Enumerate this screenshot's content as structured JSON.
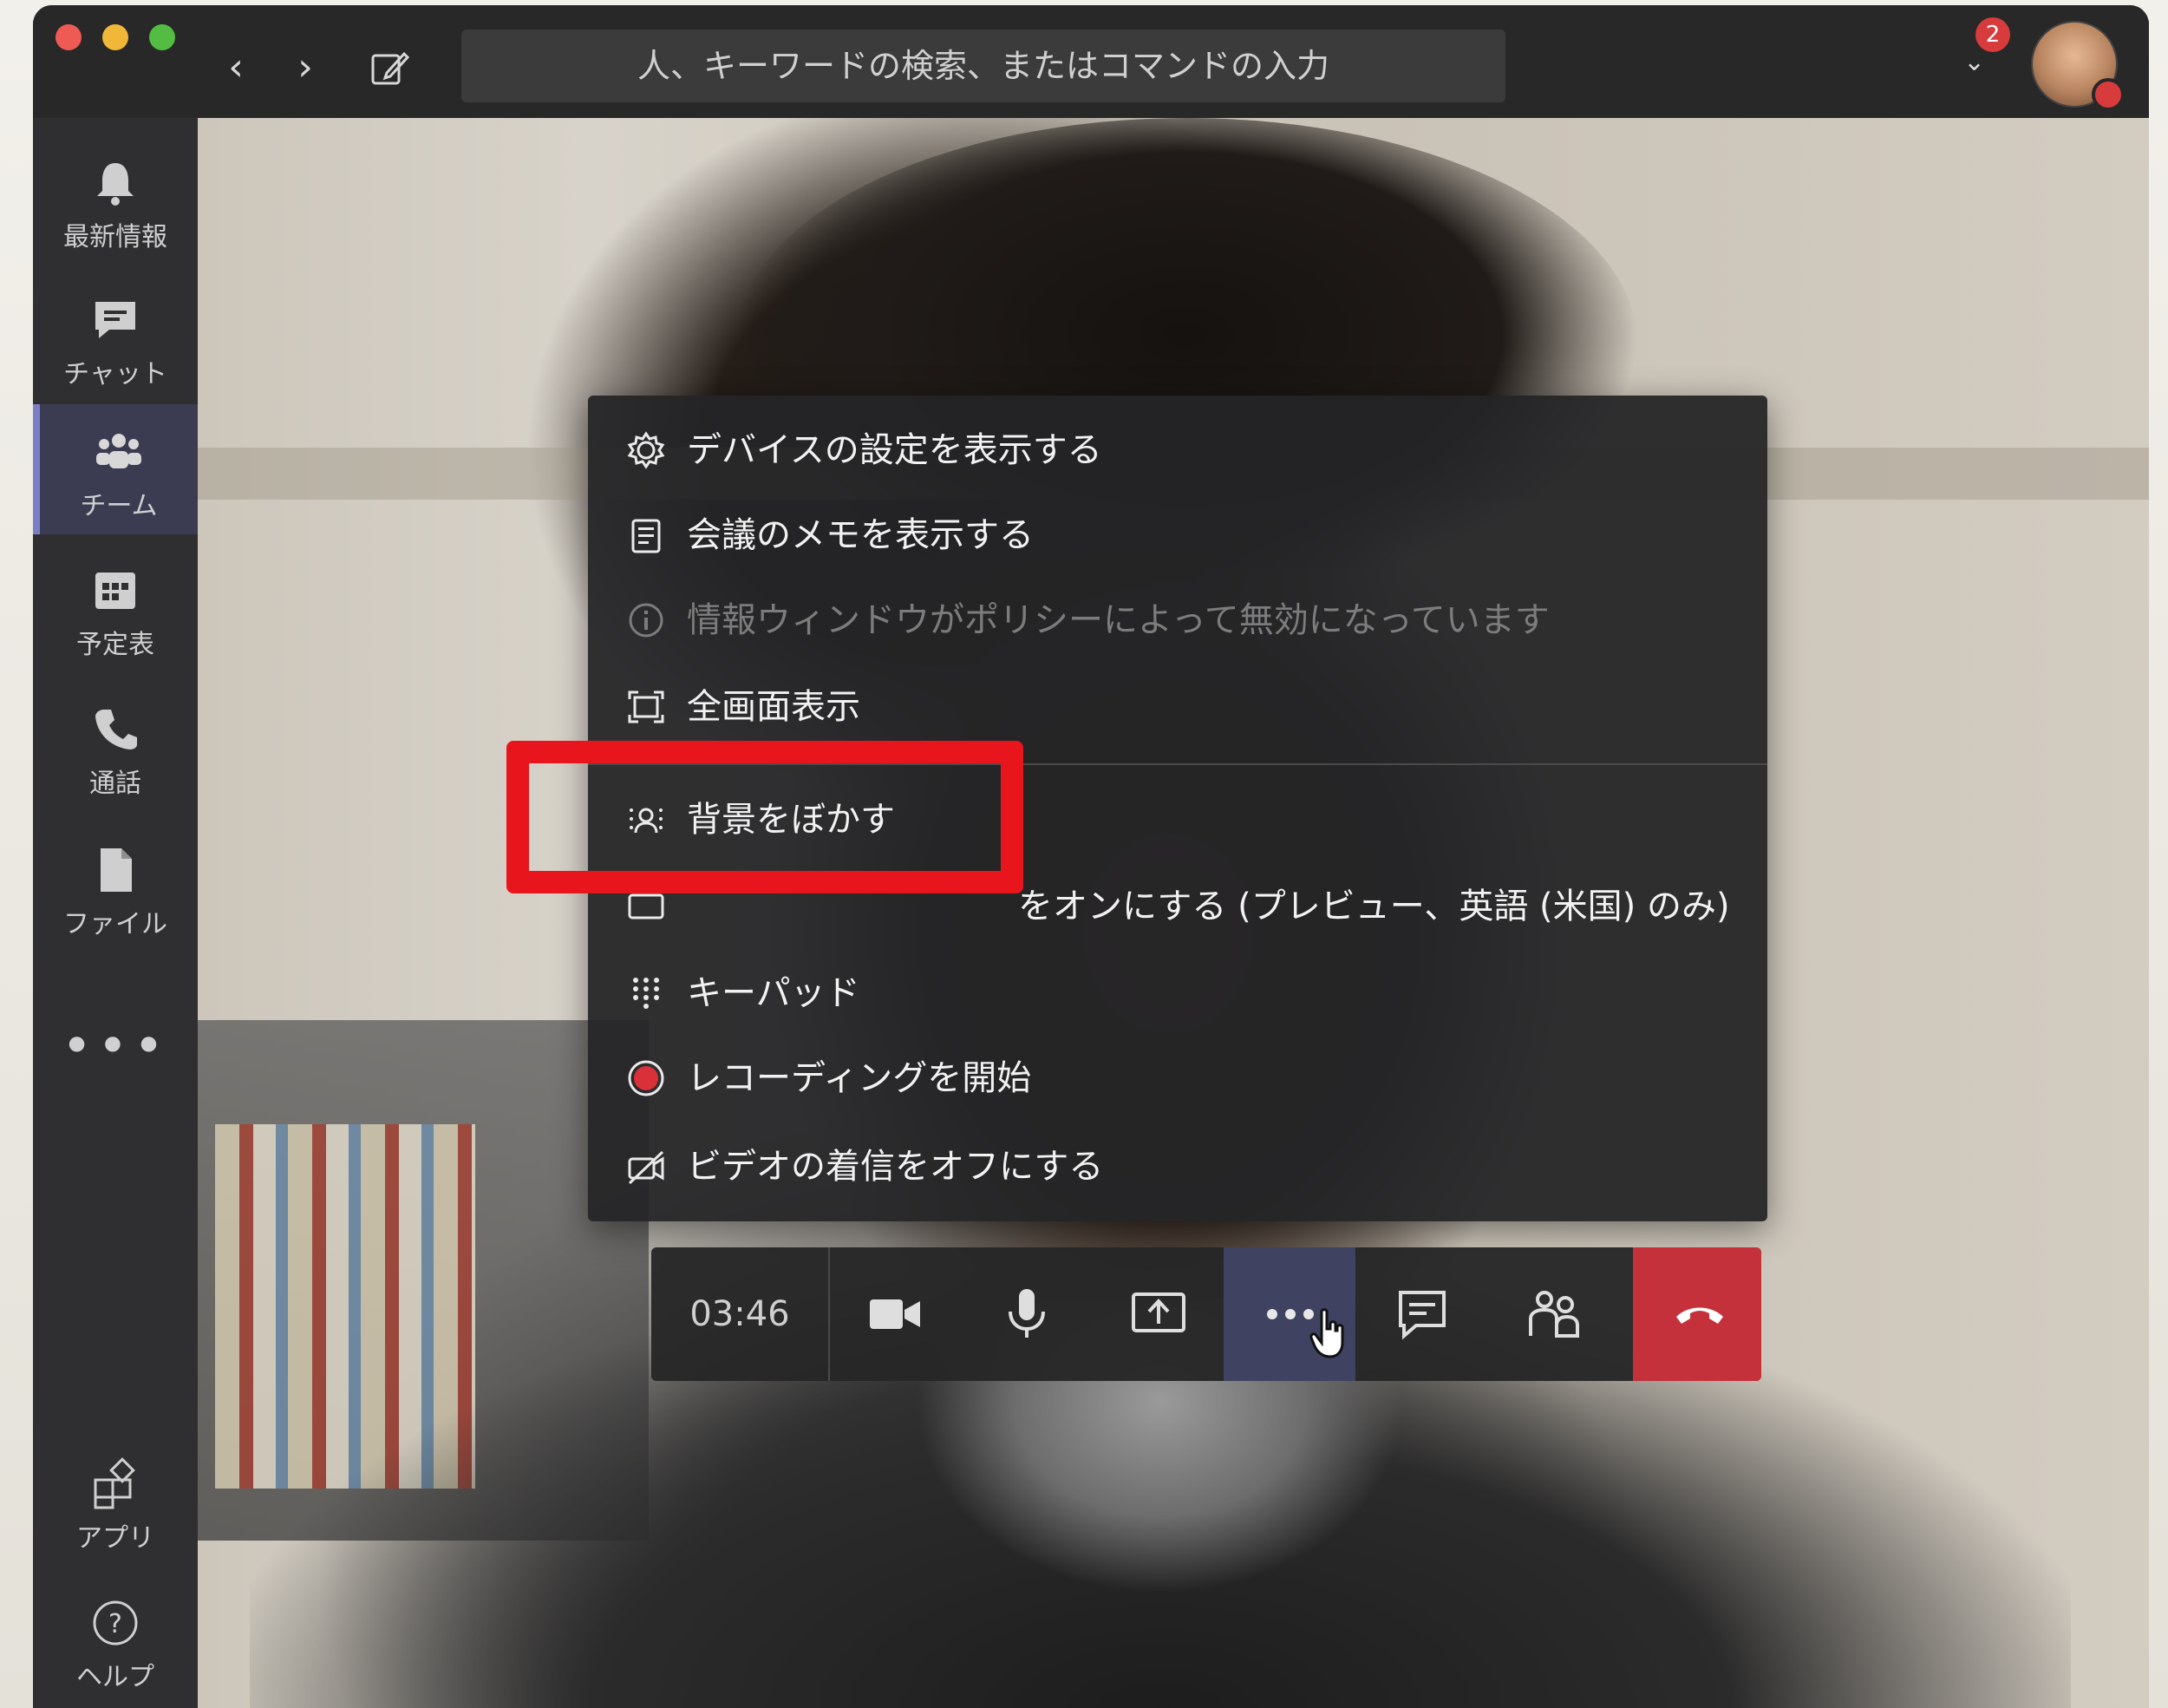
{
  "titlebar": {
    "search_placeholder": "人、キーワードの検索、またはコマンドの入力",
    "notification_count": "2"
  },
  "rail": {
    "items": [
      {
        "label": "最新情報",
        "icon": "bell-icon"
      },
      {
        "label": "チャット",
        "icon": "chat-icon"
      },
      {
        "label": "チーム",
        "icon": "teams-icon",
        "active": true
      },
      {
        "label": "予定表",
        "icon": "calendar-icon"
      },
      {
        "label": "通話",
        "icon": "phone-icon"
      },
      {
        "label": "ファイル",
        "icon": "file-icon"
      }
    ],
    "more": "•••",
    "apps_label": "アプリ",
    "help_label": "ヘルプ"
  },
  "menu": {
    "items": [
      {
        "label": "デバイスの設定を表示する",
        "icon": "gear-icon",
        "disabled": false
      },
      {
        "label": "会議のメモを表示する",
        "icon": "notes-icon",
        "disabled": false
      },
      {
        "label": "情報ウィンドウがポリシーによって無効になっています",
        "icon": "info-icon",
        "disabled": true
      },
      {
        "label": "全画面表示",
        "icon": "fullscreen-icon",
        "disabled": false
      },
      {
        "label": "背景をぼかす",
        "icon": "blur-background-icon",
        "disabled": false
      },
      {
        "label": "をオンにする (プレビュー、英語 (米国) のみ)",
        "icon": "captions-icon",
        "disabled": false
      },
      {
        "label": "キーパッド",
        "icon": "keypad-icon",
        "disabled": false
      },
      {
        "label": "レコーディングを開始",
        "icon": "record-icon",
        "disabled": false
      },
      {
        "label": "ビデオの着信をオフにする",
        "icon": "video-off-icon",
        "disabled": false
      }
    ]
  },
  "controls": {
    "timer": "03:46"
  },
  "colors": {
    "highlight": "#e8151d",
    "hangup": "#c4313a",
    "badge": "#d83b3b",
    "accent": "#7b7fc6"
  }
}
